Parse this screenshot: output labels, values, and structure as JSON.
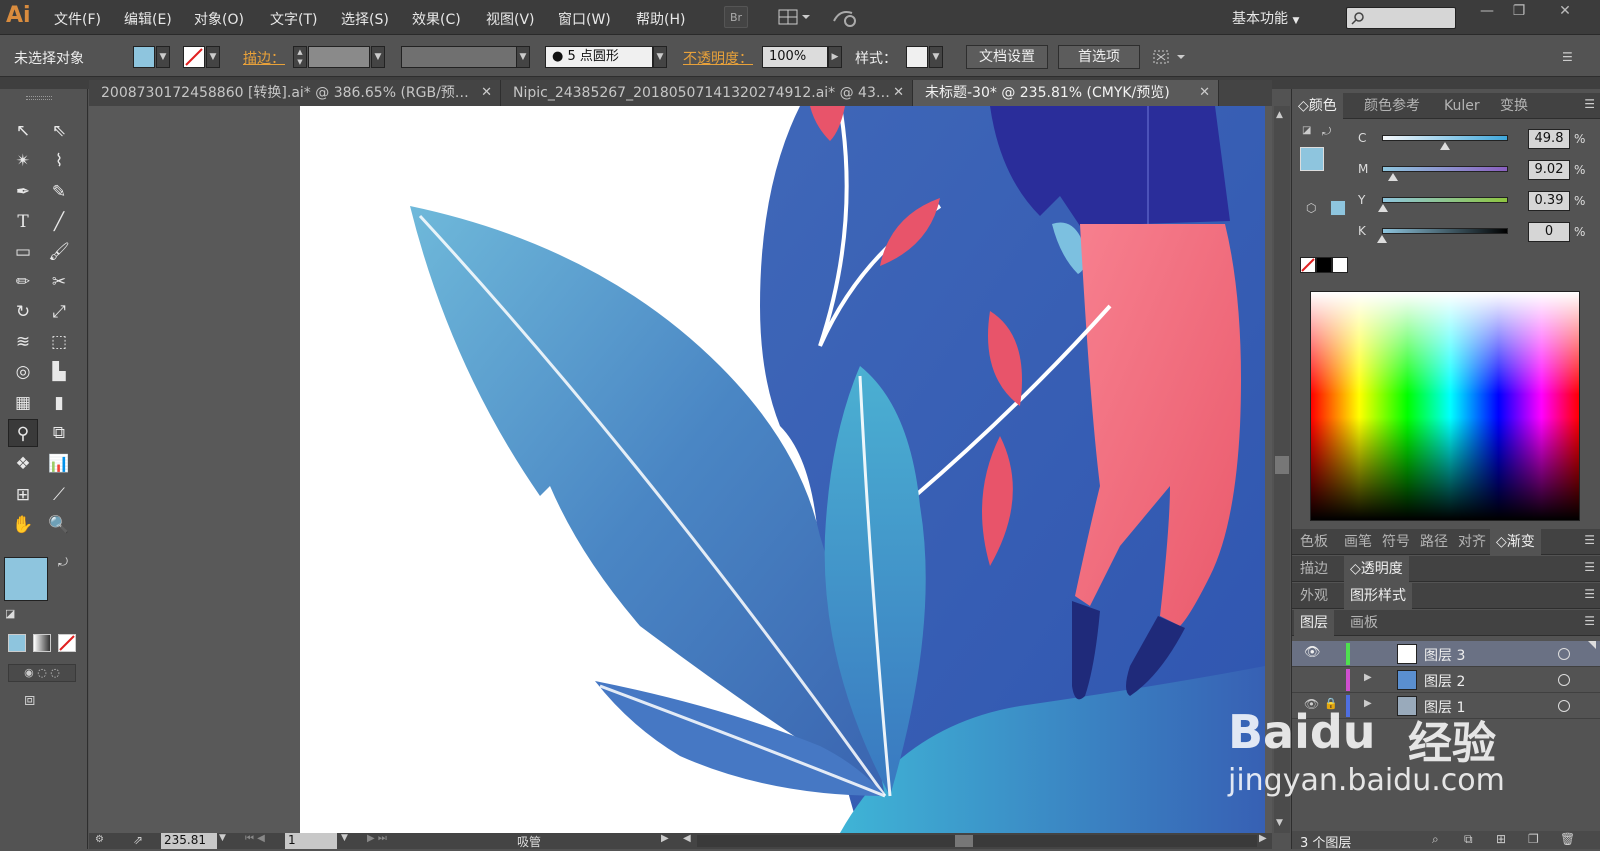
{
  "app": {
    "logo": "Ai"
  },
  "menu": [
    "文件(F)",
    "编辑(E)",
    "对象(O)",
    "文字(T)",
    "选择(S)",
    "效果(C)",
    "视图(V)",
    "窗口(W)",
    "帮助(H)"
  ],
  "menubar_extra": {
    "bridge": "Br",
    "workspace": "基本功能"
  },
  "control_bar": {
    "selection_status": "未选择对象",
    "stroke_label": "描边：",
    "brush_value": "5 点圆形",
    "opacity_label": "不透明度：",
    "opacity_value": "100%",
    "style_label": "样式：",
    "doc_setup_button": "文档设置",
    "prefs_button": "首选项"
  },
  "tabs": [
    {
      "label": "2008730172458860 [转换].ai* @ 386.65% (RGB/预…",
      "active": false
    },
    {
      "label": "Nipic_24385267_20180507141320274912.ai* @ 43…",
      "active": false
    },
    {
      "label": "未标题-30* @ 235.81% (CMYK/预览)",
      "active": true
    }
  ],
  "status": {
    "zoom": "235.81",
    "page": "1",
    "tool_name": "吸管"
  },
  "color_panel": {
    "tabs": [
      "颜色",
      "颜色参考",
      "Kuler",
      "变换"
    ],
    "channels": [
      {
        "label": "C",
        "value": "49.8",
        "level": 0.498,
        "unit": "%"
      },
      {
        "label": "M",
        "value": "9.02",
        "level": 0.09,
        "unit": "%"
      },
      {
        "label": "Y",
        "value": "0.39",
        "level": 0.004,
        "unit": "%"
      },
      {
        "label": "K",
        "value": "0",
        "level": 0.0,
        "unit": "%"
      }
    ],
    "fill_color": "#8ec5de"
  },
  "panel_groups": {
    "swatches_tabs": [
      "色板",
      "画笔",
      "符号",
      "路径",
      "对齐",
      "渐变"
    ],
    "stroke_tabs": [
      "描边",
      "透明度"
    ],
    "appearance_tabs": [
      "外观",
      "图形样式"
    ],
    "layers_tabs": [
      "图层",
      "画板"
    ]
  },
  "layers": [
    {
      "name": "图层 3",
      "selected": true
    },
    {
      "name": "图层 2",
      "selected": false
    },
    {
      "name": "图层 1",
      "selected": false
    }
  ],
  "layers_footer": "3 个图层",
  "watermark": {
    "brand": "Baidu",
    "cn": "经验",
    "url": "jingyan.baidu.com"
  },
  "colors": {
    "accent": "#e8a13a",
    "fill": "#8ec5de",
    "panel_bg": "#535353"
  }
}
